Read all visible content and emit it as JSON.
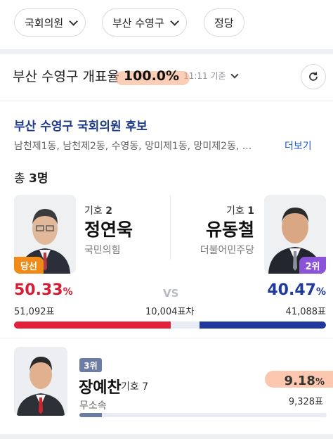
{
  "filters": [
    {
      "label": "국회의원"
    },
    {
      "label": "부산 수영구"
    },
    {
      "label": "정당"
    }
  ],
  "count": {
    "title": "부산 수영구 개표율",
    "percent": "100.0%",
    "time": "11:11 기준"
  },
  "candidates_header": {
    "title": "부산 수영구 국회의원 후보",
    "dongs": "남천제1동, 남천제2동, 수영동, 망미제1동, 망미제2동, ...",
    "more": "더보기"
  },
  "total": {
    "prefix": "총",
    "count": "3명"
  },
  "left": {
    "number_label": "기호",
    "number": "2",
    "name": "정연욱",
    "party": "국민의힘",
    "badge": "당선",
    "percent": "50.33",
    "percent_unit": "%",
    "votes": "51,092표",
    "color": "#e4213a",
    "share": 0.5033
  },
  "right": {
    "number_label": "기호",
    "number": "1",
    "name": "유동철",
    "party": "더불어민주당",
    "badge": "2위",
    "percent": "40.47",
    "percent_unit": "%",
    "votes": "41,088표",
    "color": "#1f3a9c",
    "share": 0.4047
  },
  "vs": {
    "label": "VS",
    "diff": "10,004표차"
  },
  "third": {
    "rank": "3위",
    "name": "장예찬",
    "number_label": "기호",
    "number": "7",
    "party": "무소속",
    "percent": "9.18",
    "percent_unit": "%",
    "votes": "9,328표",
    "share": 0.0918
  },
  "icons": {
    "refresh": "refresh-icon",
    "dropdown": "chevron-down-icon"
  }
}
